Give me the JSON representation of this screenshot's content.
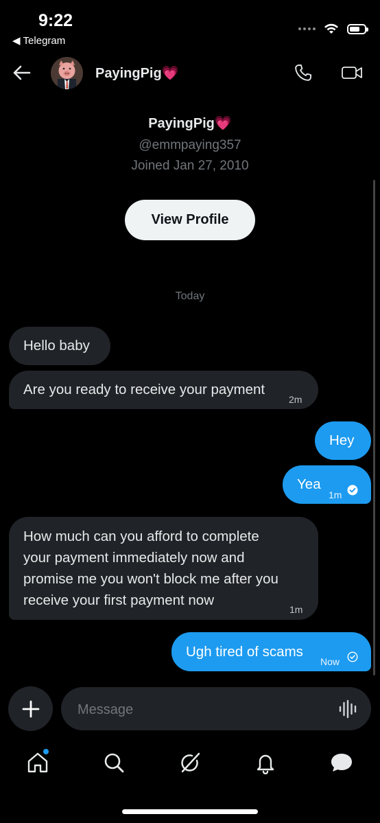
{
  "status_bar": {
    "time": "9:22",
    "back_app": "Telegram"
  },
  "header": {
    "name": "PayingPig",
    "name_emoji": "💗"
  },
  "profile": {
    "name": "PayingPig",
    "name_emoji": "💗",
    "handle": "@emmpaying357",
    "joined": "Joined Jan 27, 2010",
    "view_profile_label": "View Profile"
  },
  "conversation": {
    "day_label": "Today",
    "messages": [
      {
        "side": "in",
        "text": "Hello baby"
      },
      {
        "side": "in",
        "text": "Are you ready to receive your payment",
        "time": "2m"
      },
      {
        "side": "out",
        "text": "Hey"
      },
      {
        "side": "out",
        "text": "Yea",
        "time": "1m",
        "status": "read"
      },
      {
        "side": "in",
        "lines": [
          "How much can you afford to complete",
          "your payment immediately now and",
          "promise me you won't block me after you",
          "receive your first payment now"
        ],
        "time": "1m"
      },
      {
        "side": "out",
        "text": "Ugh tired of scams",
        "time": "Now",
        "status": "sent"
      }
    ]
  },
  "composer": {
    "placeholder": "Message"
  },
  "nav": {
    "items": [
      "home-icon",
      "search-icon",
      "grok-icon",
      "notifications-icon",
      "messages-icon"
    ],
    "home_has_badge": true
  },
  "colors": {
    "accent": "#1d9bf0",
    "incoming_bubble": "#202327",
    "background": "#000000"
  }
}
